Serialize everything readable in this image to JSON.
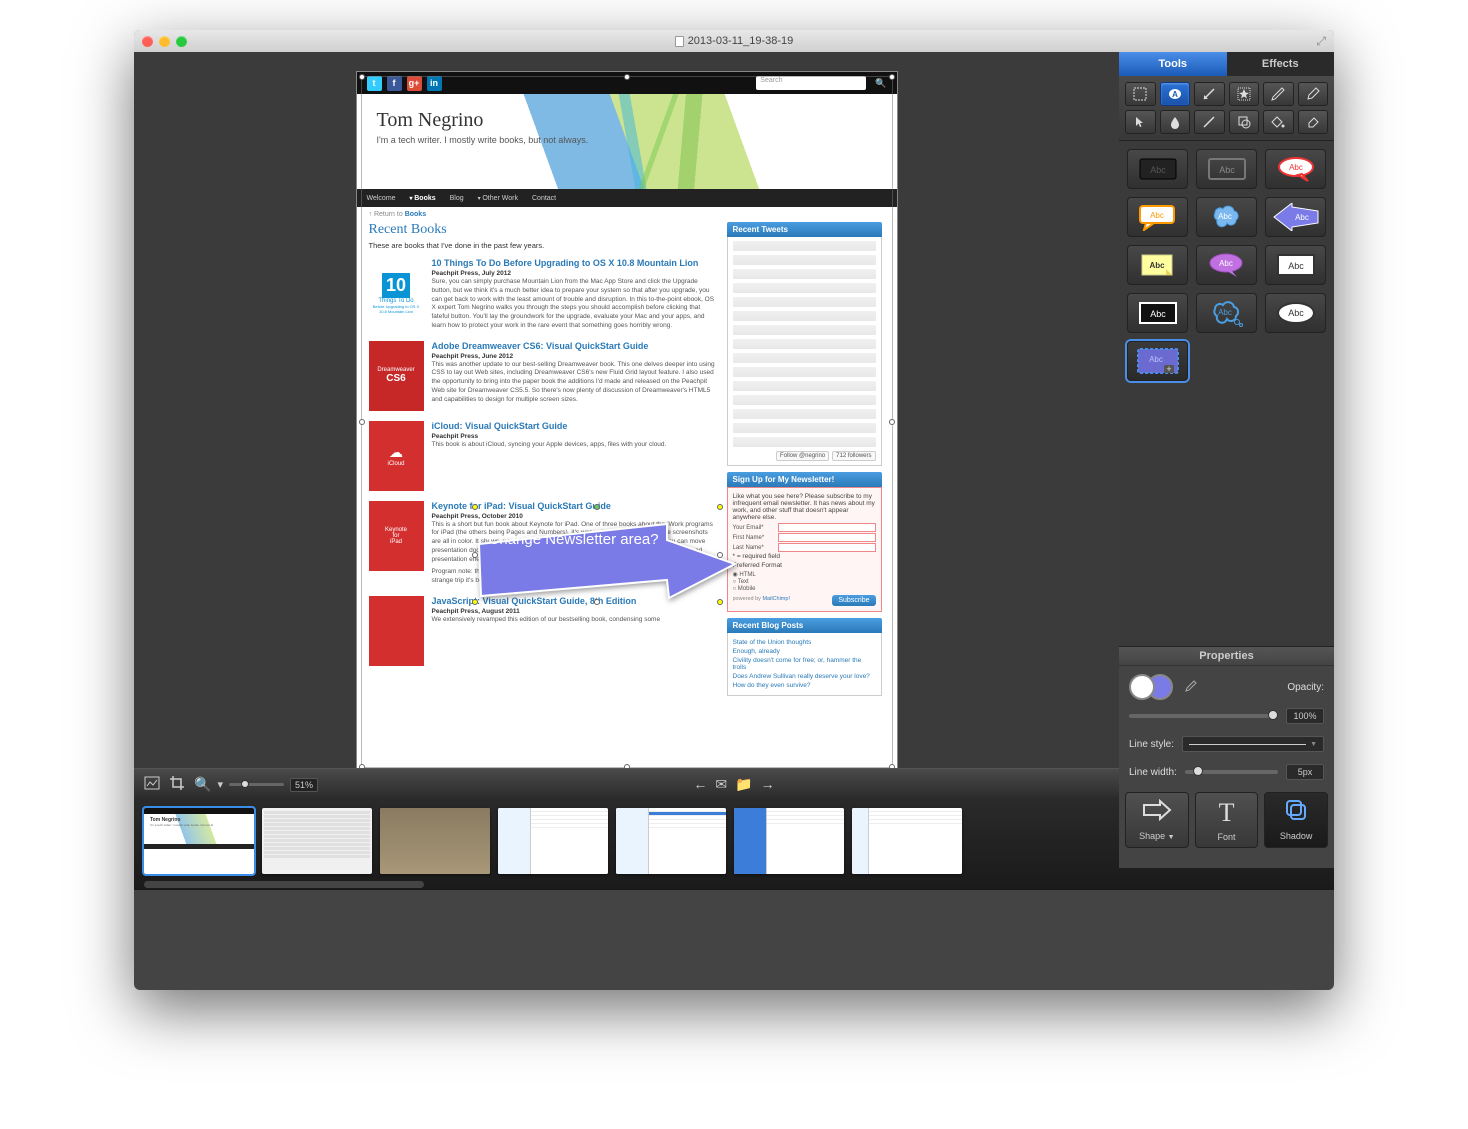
{
  "window": {
    "title": "2013-03-11_19-38-19"
  },
  "site": {
    "social": [
      "t",
      "f",
      "g+",
      "in"
    ],
    "search_placeholder": "Search",
    "author": "Tom Negrino",
    "tagline": "I'm a tech writer. I mostly write books, but not always.",
    "nav": {
      "welcome": "Welcome",
      "books": "Books",
      "blog": "Blog",
      "other": "Other Work",
      "contact": "Contact"
    },
    "breadcrumb_prefix": "↑ Return to ",
    "breadcrumb_link": "Books",
    "heading": "Recent Books",
    "intro": "These are books that I've done in the past few years.",
    "books": [
      {
        "cover": "10\nThings To Do",
        "title": "10 Things To Do Before Upgrading to OS X 10.8 Mountain Lion",
        "pub": "Peachpit Press, July 2012",
        "desc": "Sure, you can simply purchase Mountain Lion from the Mac App Store and click the Upgrade button, but we think it's a much better idea to prepare your system so that after you upgrade, you can get back to work with the least amount of trouble and disruption. In this to-the-point ebook, OS X expert Tom Negrino walks you through the steps you should accomplish before clicking that fateful button. You'll lay the groundwork for the upgrade, evaluate your Mac and your apps, and learn how to protect your work in the rare event that something goes horribly wrong."
      },
      {
        "cover": "Dreamweaver\nCS6",
        "title": "Adobe Dreamweaver CS6: Visual QuickStart Guide",
        "pub": "Peachpit Press, June 2012",
        "desc": "This was another update to our best-selling Dreamweaver book. This one delves deeper into using CSS to lay out Web sites, including Dreamweaver CS6's new Fluid Grid layout feature. I also used the opportunity to bring into the paper book the additions I'd made and released on the Peachpit Web site for Dreamweaver CS5.5. So there's now plenty of discussion of Dreamweaver's HTML5 and capabilities to design for multiple screen sizes."
      },
      {
        "cover": "iCloud",
        "title": "iCloud: Visual QuickStart Guide",
        "pub": "Peachpit Press",
        "desc": "This book is about iCloud, syncing your Apple devices, apps, files with your cloud."
      },
      {
        "cover": "Keynote\nfor\niPad",
        "title": "Keynote for iPad: Visual QuickStart Guide",
        "pub": "Peachpit Press, October 2010",
        "desc": "This is a short but fun book about Keynote for iPad. One of three books about the iWork programs for iPad (the others being Pages and Numbers), it's was written in a month, and the screenshots are all in color. It shows you how to build a presentation in Keynote for iPad, how you can move presentation documents between the Mac and iPad, and gives tips of making your iPad-based presentation effective.",
        "note": "Program note: this was also my fortieth book since I started as a book author in 1994. What a long, strange trip it's been."
      },
      {
        "cover": "",
        "title": "JavaScript: Visual QuickStart Guide, 8th Edition",
        "pub": "Peachpit Press, August 2011",
        "desc": "We extensively revamped this edition of our bestselling book, condensing some"
      }
    ],
    "widgets": {
      "tweets": {
        "title": "Recent Tweets",
        "follow": "Follow @negrino",
        "followers": "712 followers"
      },
      "newsletter": {
        "title": "Sign Up for My Newsletter!",
        "blurb": "Like what you see here? Please subscribe to my infrequent email newsletter. It has news about my work, and other stuff that doesn't appear anywhere else.",
        "email": "Your Email*",
        "first": "First Name*",
        "last": "Last Name*",
        "req": "* = required field",
        "pref": "Preferred Format",
        "opt_html": "HTML",
        "opt_text": "Text",
        "opt_mobile": "Mobile",
        "subscribe": "Subscribe",
        "powered": "powered by ",
        "mc": "MailChimp!"
      },
      "blog": {
        "title": "Recent Blog Posts",
        "posts": [
          "State of the Union thoughts",
          "Enough, already",
          "Civility doesn't come for free; or, hammer the trolls",
          "Does Andrew Sullivan really deserve your love?",
          "How do they even survive?"
        ]
      }
    }
  },
  "annotation": {
    "text": "Change Newsletter area?"
  },
  "rpanel": {
    "tabs": {
      "tools": "Tools",
      "effects": "Effects"
    },
    "abc": "Abc"
  },
  "props": {
    "title": "Properties",
    "opacity_label": "Opacity:",
    "opacity_val": "100%",
    "linestyle_label": "Line style:",
    "linewidth_label": "Line width:",
    "linewidth_val": "5px",
    "shape": "Shape",
    "shape_dd": "▼",
    "font": "Font",
    "shadow": "Shadow"
  },
  "toolbar": {
    "zoom": "51%"
  }
}
